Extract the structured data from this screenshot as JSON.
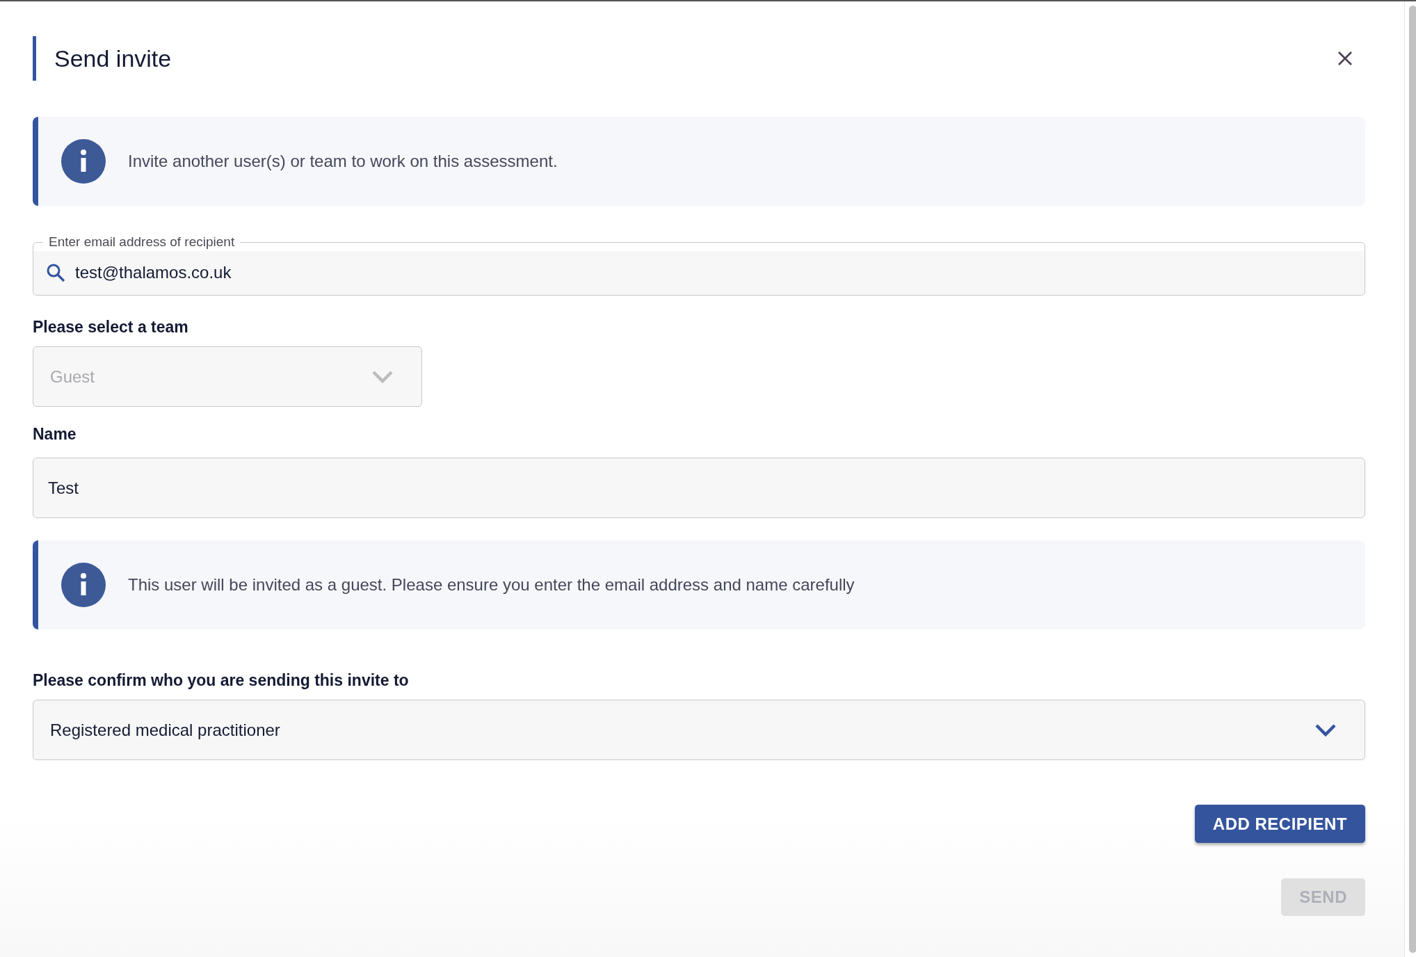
{
  "dialog": {
    "title": "Send invite"
  },
  "intro_notice": {
    "text": "Invite another user(s) or team to work on this assessment."
  },
  "email_field": {
    "label": "Enter email address of recipient",
    "value": "test@thalamos.co.uk"
  },
  "team_select": {
    "label": "Please select a team",
    "value": "Guest",
    "disabled": true
  },
  "name_field": {
    "label": "Name",
    "value": "Test"
  },
  "guest_notice": {
    "text": "This user will be invited as a guest. Please ensure you enter the email address and name carefully"
  },
  "recipient_type_select": {
    "label": "Please confirm who you are sending this invite to",
    "value": "Registered medical practitioner",
    "disabled": false
  },
  "buttons": [
    {
      "label": "ADD RECIPIENT",
      "disabled": false
    },
    {
      "label": "SEND",
      "disabled": true
    }
  ]
}
